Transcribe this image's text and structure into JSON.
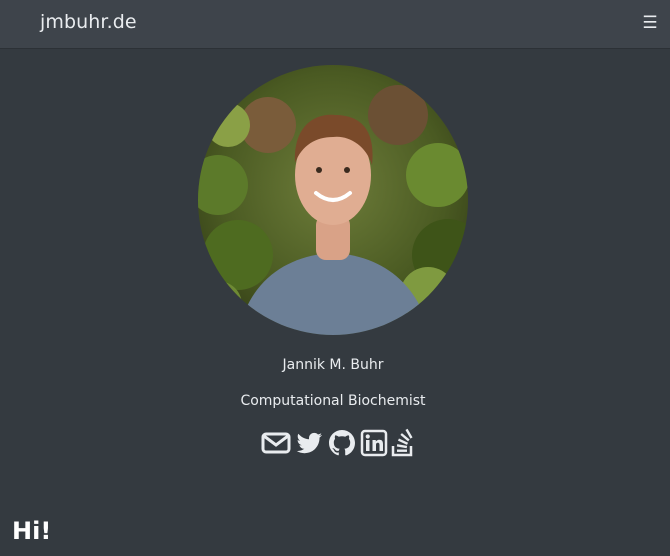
{
  "navbar": {
    "brand": "jmbuhr.de",
    "menu_icon": "hamburger-menu-icon",
    "menu_glyph": "☰"
  },
  "profile": {
    "photo": "profile-photo",
    "name": "Jannik M. Buhr",
    "title": "Computational Biochemist"
  },
  "socials": [
    {
      "icon": "email-icon"
    },
    {
      "icon": "twitter-icon"
    },
    {
      "icon": "github-icon"
    },
    {
      "icon": "linkedin-icon"
    },
    {
      "icon": "stackoverflow-icon"
    }
  ],
  "content": {
    "heading": "Hi!"
  },
  "colors": {
    "background": "#343a40",
    "navbar": "#3e444b",
    "text": "#e9ecef"
  }
}
